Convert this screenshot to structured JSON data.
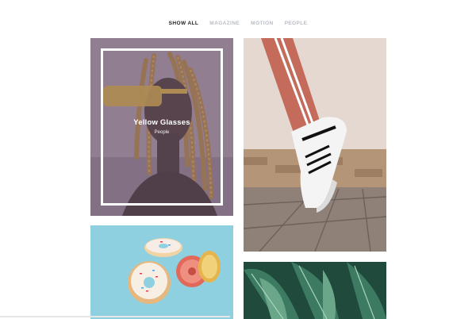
{
  "filters": [
    {
      "label": "SHOW ALL",
      "active": true
    },
    {
      "label": "MAGAZINE",
      "active": false
    },
    {
      "label": "MOTION",
      "active": false
    },
    {
      "label": "PEOPLE",
      "active": false
    }
  ],
  "gallery": {
    "items": [
      {
        "title": "Yellow Glasses",
        "category": "People",
        "icon": "woman-portrait-image"
      },
      {
        "title": "",
        "category": "",
        "icon": "sneaker-image"
      },
      {
        "title": "",
        "category": "",
        "icon": "donuts-image"
      },
      {
        "title": "",
        "category": "",
        "icon": "plant-leaves-image"
      }
    ]
  },
  "colors": {
    "overlay": "#7b6a86",
    "active_filter": "#222222",
    "inactive_filter": "#b8bcc4"
  }
}
